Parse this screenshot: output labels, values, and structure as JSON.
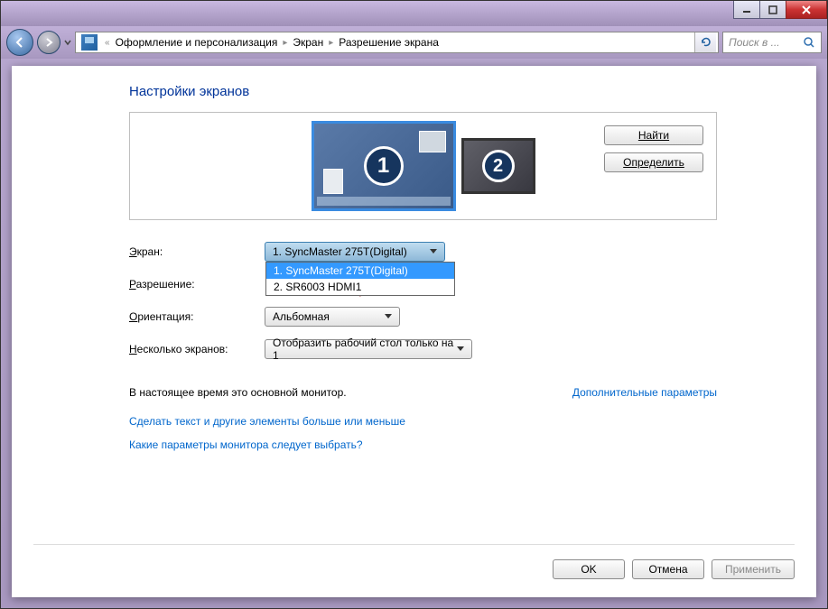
{
  "titlebar": {},
  "nav": {
    "breadcrumb": [
      "Оформление и персонализация",
      "Экран",
      "Разрешение экрана"
    ],
    "search_placeholder": "Поиск в ..."
  },
  "page": {
    "title": "Настройки экранов",
    "monitors": [
      {
        "number": "1",
        "primary": true
      },
      {
        "number": "2",
        "primary": false
      }
    ],
    "find_button": "Найти",
    "identify_button": "Определить"
  },
  "form": {
    "screen_label": "Экран:",
    "screen_value": "1. SyncMaster 275T(Digital)",
    "screen_options": [
      "1. SyncMaster 275T(Digital)",
      "2. SR6003 HDMI1"
    ],
    "resolution_label": "Разрешение:",
    "orientation_label": "Ориентация:",
    "orientation_value": "Альбомная",
    "multi_label": "Несколько экранов:",
    "multi_value": "Отобразить рабочий стол только на 1"
  },
  "status": {
    "main_monitor": "В настоящее время это основной монитор.",
    "advanced": "Дополнительные параметры"
  },
  "links": {
    "textsize": "Сделать текст и другие элементы больше или меньше",
    "help": "Какие параметры монитора следует выбрать?"
  },
  "buttons": {
    "ok": "OK",
    "cancel": "Отмена",
    "apply": "Применить"
  }
}
